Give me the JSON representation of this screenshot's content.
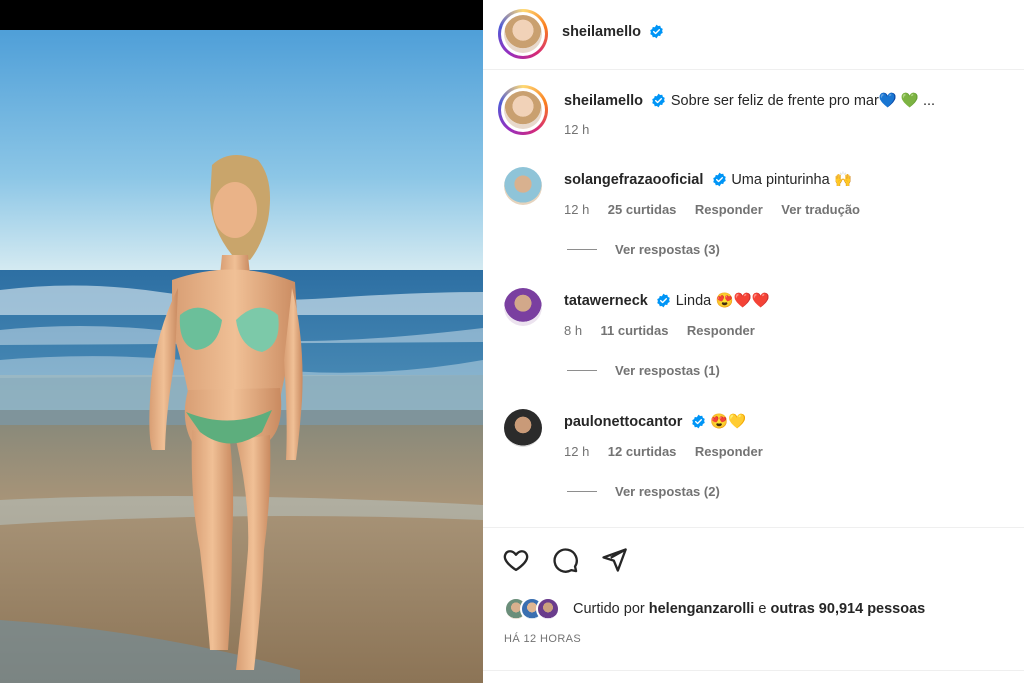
{
  "post": {
    "author": "sheilamello",
    "caption": "Sobre ser feliz de frente pro mar",
    "caption_emoji": "💙 💚 ...",
    "time": "12 h"
  },
  "comments": [
    {
      "user": "solangefrazaooficial",
      "text": "Uma pinturinha",
      "emoji": "🙌",
      "time": "12 h",
      "likes": "25 curtidas",
      "reply": "Responder",
      "translate": "Ver tradução",
      "view_replies": "Ver respostas (3)"
    },
    {
      "user": "tatawerneck",
      "text": "Linda",
      "emoji": "😍❤️❤️",
      "time": "8 h",
      "likes": "11 curtidas",
      "reply": "Responder",
      "view_replies": "Ver respostas (1)"
    },
    {
      "user": "paulonettocantor",
      "text": "",
      "emoji": "😍💛",
      "time": "12 h",
      "likes": "12 curtidas",
      "reply": "Responder",
      "view_replies": "Ver respostas (2)"
    }
  ],
  "likes_line": {
    "prefix": "Curtido por",
    "user": "helenganzarolli",
    "middle": "e",
    "others": "outras 90,914 pessoas"
  },
  "posted_ago": "HÁ 12 HORAS",
  "colors": {
    "verified": "#0095f6",
    "text": "#262626",
    "muted": "#737373"
  },
  "icons": [
    "heart-icon",
    "comment-icon",
    "share-icon",
    "verified-icon"
  ]
}
